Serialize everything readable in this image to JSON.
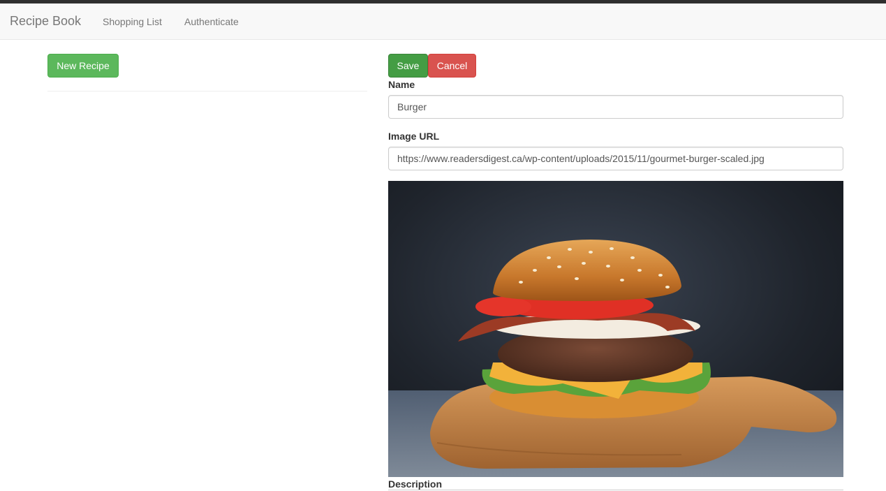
{
  "navbar": {
    "brand": "Recipe Book",
    "links": [
      "Shopping List",
      "Authenticate"
    ]
  },
  "recipe_list": {
    "new_recipe_label": "New Recipe"
  },
  "edit_form": {
    "save_label": "Save",
    "cancel_label": "Cancel",
    "name_label": "Name",
    "name_value": "Burger",
    "image_url_label": "Image URL",
    "image_url_value": "https://www.readersdigest.ca/wp-content/uploads/2015/11/gourmet-burger-scaled.jpg",
    "image_subject": "burger-photo",
    "description_label": "Description"
  },
  "colors": {
    "success": "#5cb85c",
    "success_active": "#449d44",
    "danger": "#d9534f",
    "navbar_bg": "#f8f8f8",
    "nav_text": "#777777"
  }
}
